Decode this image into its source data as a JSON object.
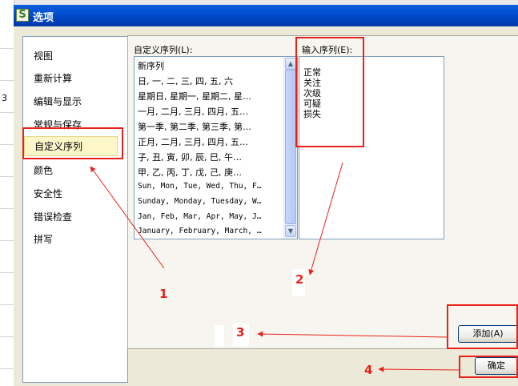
{
  "dialog": {
    "title": "选项",
    "app_icon_glyph": "S"
  },
  "nav": {
    "items": [
      "视图",
      "重新计算",
      "编辑与显示",
      "常规与保存",
      "自定义序列",
      "颜色",
      "安全性",
      "错误检查",
      "拼写"
    ],
    "selected_index": 4
  },
  "custom_lists": {
    "label": "自定义序列(L):",
    "items": [
      "新序列",
      "日, 一, 二, 三, 四, 五, 六",
      "星期日, 星期一, 星期二, 星…",
      "一月, 二月, 三月, 四月, 五…",
      "第一季, 第二季, 第三季, 第…",
      "正月, 二月, 三月, 四月, 五…",
      "子, 丑, 寅, 卯, 辰, 巳, 午…",
      "甲, 乙, 丙, 丁, 戊, 己, 庚…",
      "Sun, Mon, Tue, Wed, Thu, F…",
      "Sunday, Monday, Tuesday, W…",
      "Jan, Feb, Mar, Apr, May, J…",
      "January, February, March, …"
    ]
  },
  "input_list": {
    "label": "输入序列(E):",
    "entries": [
      "正常",
      "关注",
      "次级",
      "可疑",
      "损失"
    ]
  },
  "buttons": {
    "add": "添加(A)",
    "ok": "确定"
  },
  "annotations": {
    "n1": "1",
    "n2": "2",
    "n3": "3",
    "n4": "4",
    "color": "#e8221b"
  },
  "background": {
    "left_marks": [
      "3"
    ]
  }
}
